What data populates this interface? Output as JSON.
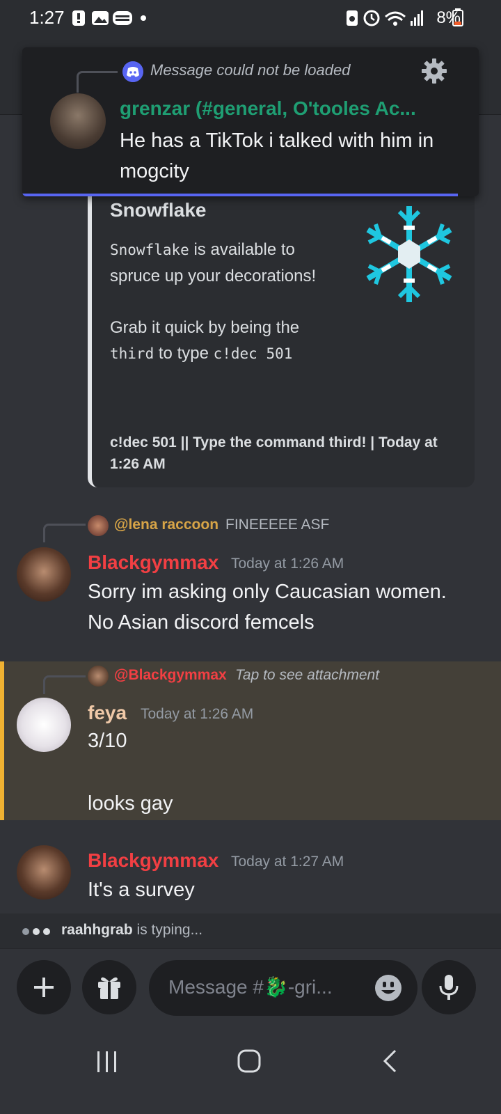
{
  "status_bar": {
    "time": "1:27",
    "battery": "8%"
  },
  "notification": {
    "app_icon": "discord-icon",
    "header": "Message could not be loaded",
    "author": "grenzar (#general, O'tooles Ac...",
    "body": "He has a TikTok i talked with him in mogcity",
    "accent_color": "#5865f2",
    "author_color": "#1f9e73"
  },
  "embed": {
    "title": "Snowflake",
    "desc_line1_code": "Snowflake",
    "desc_line1_rest": " is available to spruce up your decorations!",
    "desc_line2_pre": "Grab it quick by being the ",
    "desc_line2_code1": "third",
    "desc_line2_mid": " to type ",
    "desc_line2_code2": "c!dec 501",
    "footer": "c!dec 501 || Type the command third! | Today at 1:26 AM",
    "icon": "snowflake-icon"
  },
  "messages": [
    {
      "reply_to": "@lena raccoon",
      "reply_text": "FINEEEEE ASF",
      "reply_color": "#d7a447",
      "author": "Blackgymmax",
      "author_color": "#f23f43",
      "timestamp": "Today at 1:26 AM",
      "text": "Sorry im asking only Caucasian women. No Asian discord femcels"
    },
    {
      "reply_to": "@Blackgymmax",
      "reply_text": "Tap to see attachment",
      "reply_color": "#f23f43",
      "author": "feya",
      "author_color": "#f0c9a8",
      "timestamp": "Today at 1:26 AM",
      "text_line1": "3/10",
      "text_line2": "looks gay"
    },
    {
      "author": "Blackgymmax",
      "author_color": "#f23f43",
      "timestamp": "Today at 1:27 AM",
      "text": "It's a survey"
    }
  ],
  "typing": {
    "user": "raahhgrab",
    "suffix": " is typing..."
  },
  "composer": {
    "placeholder": "Message #🐉-gri..."
  }
}
